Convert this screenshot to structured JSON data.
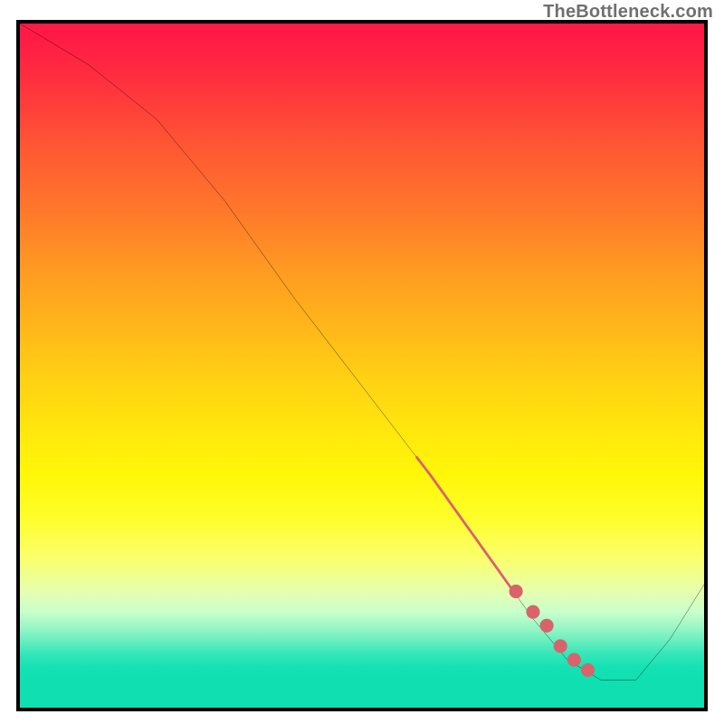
{
  "watermark": "TheBottleneck.com",
  "chart_data": {
    "type": "line",
    "title": "",
    "xlabel": "",
    "ylabel": "",
    "xlim": [
      0,
      100
    ],
    "ylim": [
      0,
      100
    ],
    "grid": false,
    "series": [
      {
        "name": "bottleneck-curve",
        "color": "#000000",
        "x": [
          0,
          10,
          20,
          30,
          40,
          50,
          60,
          70,
          75,
          80,
          85,
          90,
          95,
          100
        ],
        "y": [
          100,
          94,
          86,
          74,
          60,
          47,
          34,
          20,
          13,
          7,
          4,
          4,
          10,
          18
        ]
      }
    ],
    "highlight_segment": {
      "name": "highlight-range",
      "color": "#d9636a",
      "thick_range": {
        "x_start": 58,
        "x_end": 72
      },
      "dots": [
        {
          "x": 72.5,
          "y": 17
        },
        {
          "x": 75,
          "y": 14
        },
        {
          "x": 77,
          "y": 12
        },
        {
          "x": 79,
          "y": 9
        },
        {
          "x": 81,
          "y": 7
        },
        {
          "x": 83,
          "y": 5.5
        }
      ]
    },
    "background_gradient": {
      "top": "#ff1a46",
      "mid": "#fff708",
      "bottom": "#0fdfb1"
    }
  }
}
